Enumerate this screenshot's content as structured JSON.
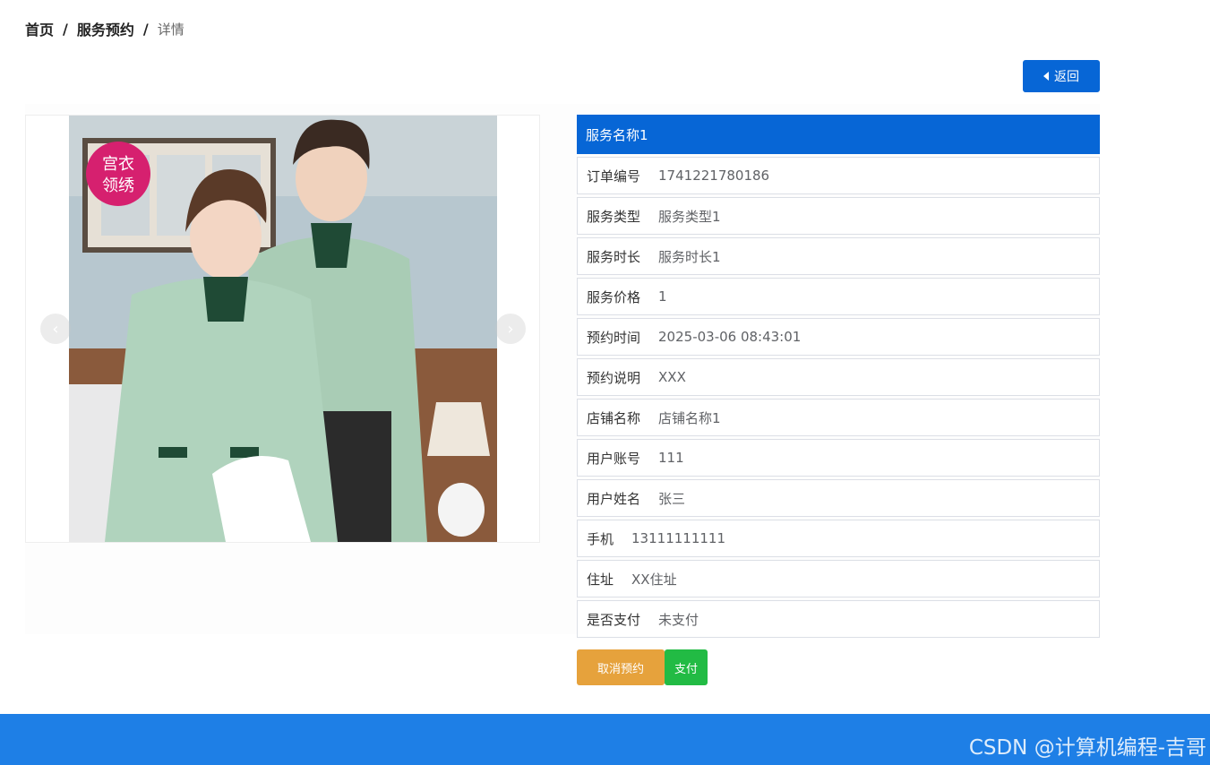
{
  "breadcrumb": {
    "home": "首页",
    "section": "服务预约",
    "current": "详情",
    "sep": "/"
  },
  "back_button": {
    "label": "返回"
  },
  "carousel": {
    "prev_glyph": "‹",
    "next_glyph": "›",
    "badge_line1": "宫衣",
    "badge_line2": "领绣"
  },
  "detail": {
    "title": "服务名称1",
    "rows": [
      {
        "label": "订单编号",
        "value": "1741221780186"
      },
      {
        "label": "服务类型",
        "value": "服务类型1"
      },
      {
        "label": "服务时长",
        "value": "服务时长1"
      },
      {
        "label": "服务价格",
        "value": "1"
      },
      {
        "label": "预约时间",
        "value": "2025-03-06 08:43:01"
      },
      {
        "label": "预约说明",
        "value": "XXX"
      },
      {
        "label": "店铺名称",
        "value": "店铺名称1"
      },
      {
        "label": "用户账号",
        "value": "111"
      },
      {
        "label": "用户姓名",
        "value": "张三"
      },
      {
        "label": "手机",
        "value": "13111111111"
      },
      {
        "label": "住址",
        "value": "XX住址"
      },
      {
        "label": "是否支付",
        "value": "未支付"
      }
    ]
  },
  "actions": {
    "cancel_label": "取消预约",
    "pay_label": "支付"
  },
  "footer": {
    "watermark": "CSDN @计算机编程-吉哥"
  },
  "colors": {
    "primary": "#0766d6",
    "warning": "#e6a23c",
    "success": "#22bb44",
    "footer": "#1e7fe6"
  }
}
